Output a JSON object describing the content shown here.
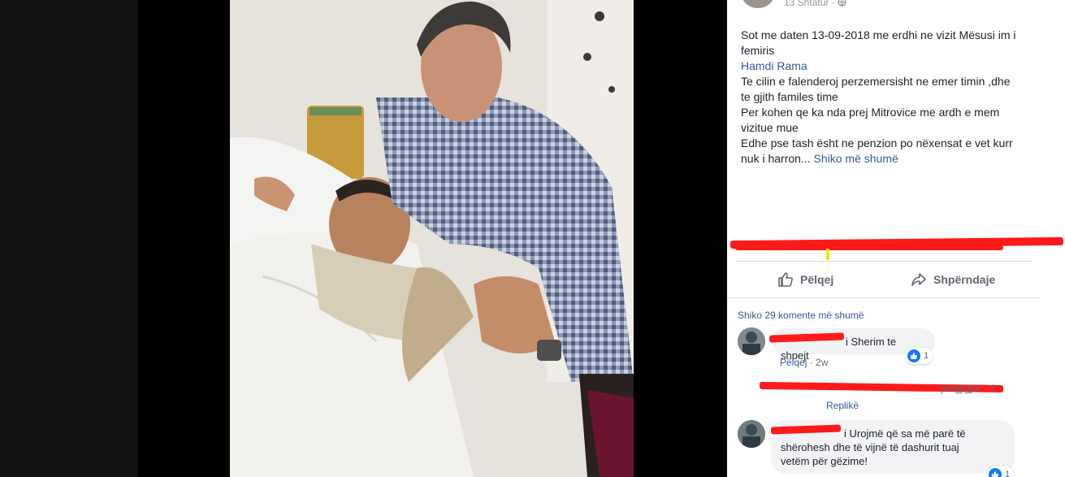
{
  "post": {
    "date": "13 Shtatur ·",
    "lines": [
      "Sot me daten 13-09-2018 me erdhi ne vizit Mësusi im i",
      "femiris"
    ],
    "mention": "Hamdi Rama",
    "lines2": [
      "Te cilin e falenderoj perzemersisht ne emer timin ,dhe",
      "te gjith familes time",
      "Per kohen qe ka nda prej Mitrovice me ardh e mem",
      "vizitue mue",
      "Edhe pse tash ësht ne penzion po nëxensat e vet kurr"
    ],
    "last_line": "nuk i harron...",
    "see_more": "Shiko më shumë"
  },
  "actions": {
    "like": "Pëlqej",
    "share": "Shpërndaje"
  },
  "comments": {
    "more": "Shiko 29 komente më shumë",
    "c1": {
      "text": "i Sherim te shpejt",
      "reactions": "1",
      "like": "Pëlqej",
      "time": "· 2w"
    },
    "reply": {
      "text": "përgjigjur · 1",
      "label": "Replikë"
    },
    "c2": {
      "line1": "i Urojmë që sa më parë të",
      "line2": "shërohesh dhe të vijnë të dashurit tuaj",
      "line3": "vetëm për gëzime!",
      "reactions": "1"
    }
  },
  "icons": {
    "like_icon": "thumbs-up-icon",
    "share_icon": "share-arrow-icon",
    "globe_icon": "globe-icon"
  },
  "colors": {
    "link": "#385898",
    "like_blue": "#1877f2",
    "redaction": "#ff1a1a"
  }
}
